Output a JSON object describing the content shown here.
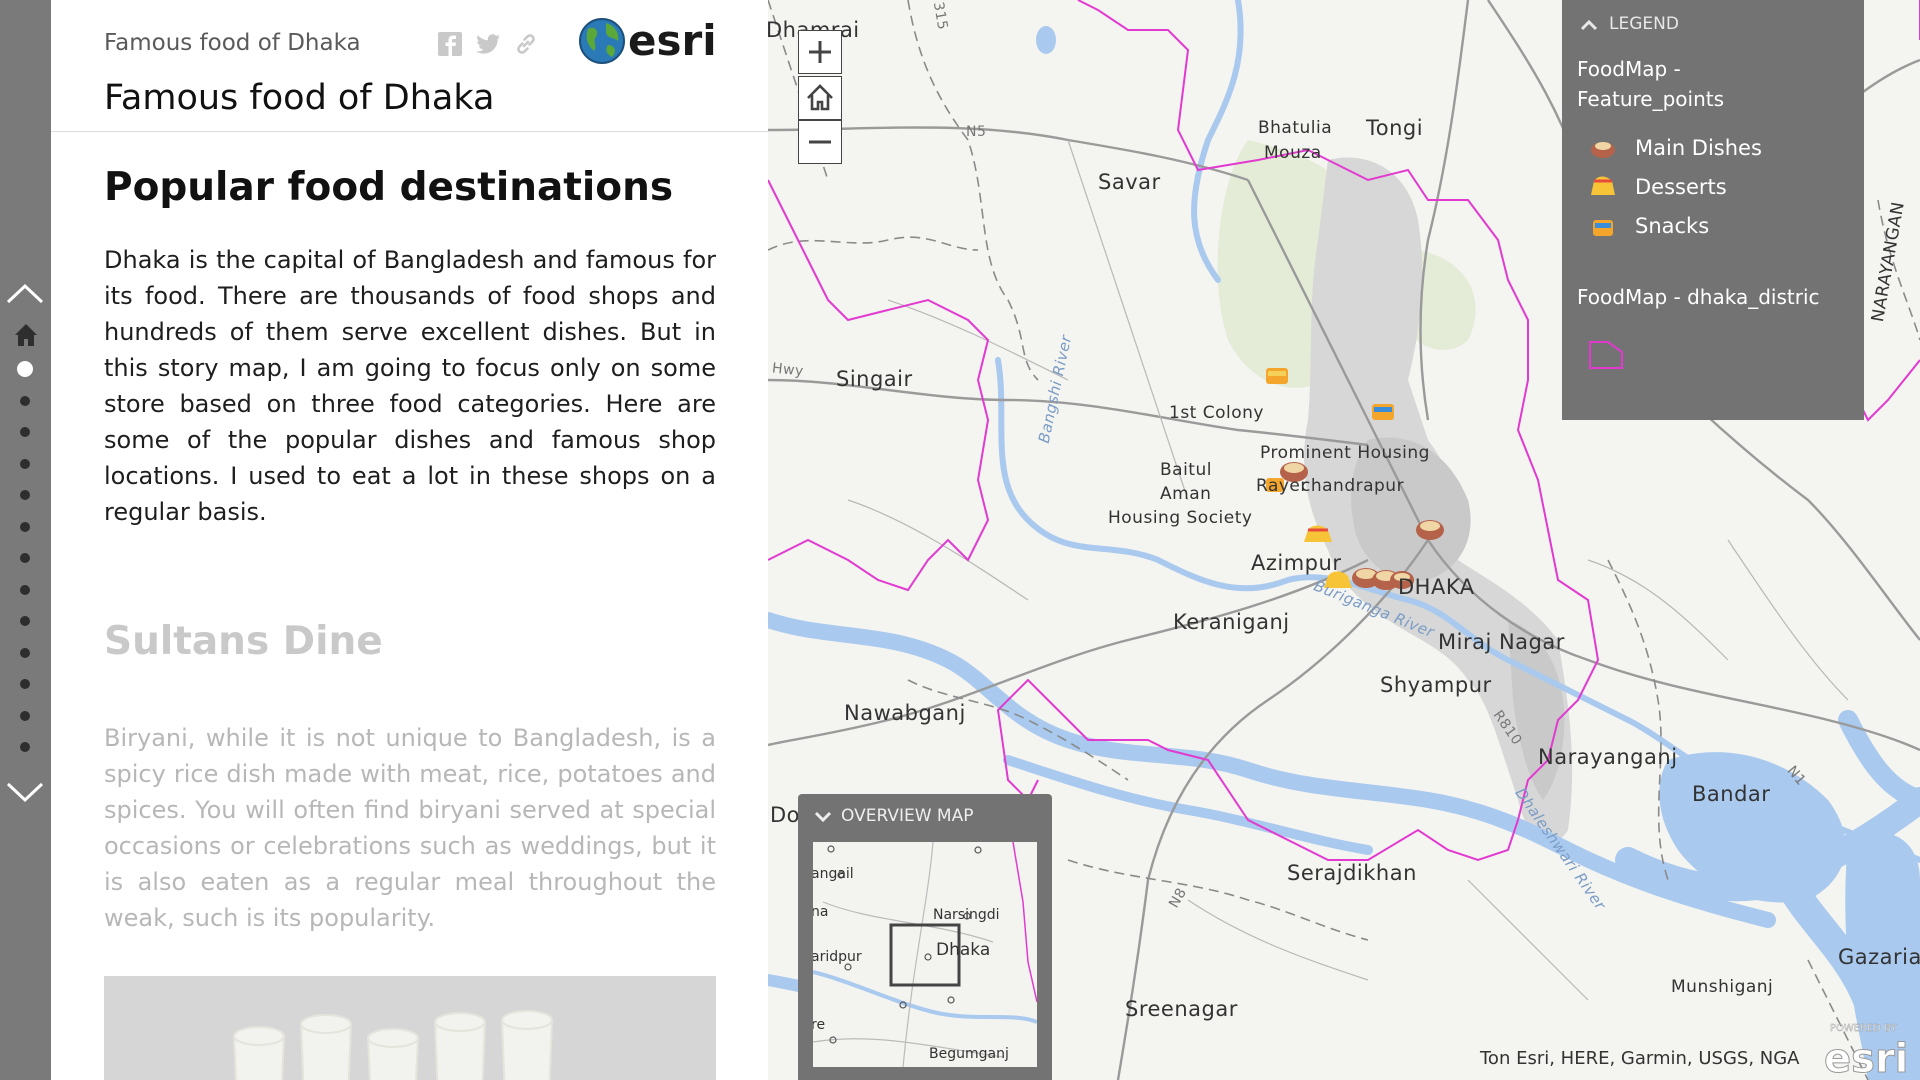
{
  "header": {
    "subtitle": "Famous food of Dhaka",
    "title": "Famous food of Dhaka",
    "logo_text": "esri"
  },
  "content": {
    "section_title": "Popular food destinations",
    "intro": "Dhaka is the capital of Bangladesh and famous for its food. There are thousands of food shops and hundreds of them serve excellent dishes. But in this story map, I am going to focus only on some store based on three food categories. Here are some of the popular dishes and famous shop locations. I used to eat a lot in these shops on a regular basis.",
    "section2_title": "Sultans Dine",
    "section2_text": "Biryani, while it is not unique to Bangladesh, is a spicy rice dish made with meat, rice, potatoes and spices. You will often find biryani served at special occasions or celebrations such as weddings, but it is also eaten as a regular meal throughout the weak, such is its popularity."
  },
  "legend": {
    "header": "LEGEND",
    "layer1_line1": "FoodMap -",
    "layer1_line2": "Feature_points",
    "items": [
      {
        "label": "Main Dishes",
        "icon": "main-dishes-icon"
      },
      {
        "label": "Desserts",
        "icon": "desserts-icon"
      },
      {
        "label": "Snacks",
        "icon": "snacks-icon"
      }
    ],
    "layer2": "FoodMap - dhaka_distric"
  },
  "overview": {
    "header": "OVERVIEW MAP",
    "places": [
      "angail",
      "na",
      "aridpur",
      "re",
      "Narsingdi",
      "Dhaka",
      "Begumganj"
    ]
  },
  "map": {
    "places": {
      "dhamrai": "Dhamrai",
      "bhatulia": "Bhatulia",
      "mouza": "Mouza",
      "tongi": "Tongi",
      "savar": "Savar",
      "singair": "Singair",
      "colony": "1st Colony",
      "prominent": "Prominent Housing",
      "baitul": "Baitul",
      "aman": "Aman",
      "housing_society": "Housing Society",
      "rayer": "Rayer",
      "chandrapur": "chandrapur",
      "azimpur": "Azimpur",
      "dhaka": "DHAKA",
      "keraniganj": "Keraniganj",
      "miraj": "Miraj Nagar",
      "shyampur": "Shyampur",
      "nawabganj": "Nawabganj",
      "narayanganj": "Narayanganj",
      "bandar": "Bandar",
      "serajdikhan": "Serajdikhan",
      "sreenagar": "Sreenagar",
      "munshiganj": "Munshiganj",
      "gazaria": "Gazaria",
      "narayangan_edge": "NARAYANGAN",
      "do": "Do",
      "hwy": "Hwy",
      "n5": "N5",
      "n8": "N8",
      "n1": "N1",
      "r810": "R810",
      "buriganga": "Buriganga River",
      "dhaleshwari": "Dhaleshwari River",
      "bangshi": "Bangshi River",
      "b315": "315"
    },
    "attribution": "Ton Esri, HERE, Garmin, USGS, NGA",
    "powered_by": "POWERED BY",
    "powered_logo": "esri"
  },
  "colors": {
    "nav_rail": "#7a7a7a",
    "legend_bg": "#737373",
    "boundary": "#e23ad0",
    "river": "#a9c9ee"
  }
}
